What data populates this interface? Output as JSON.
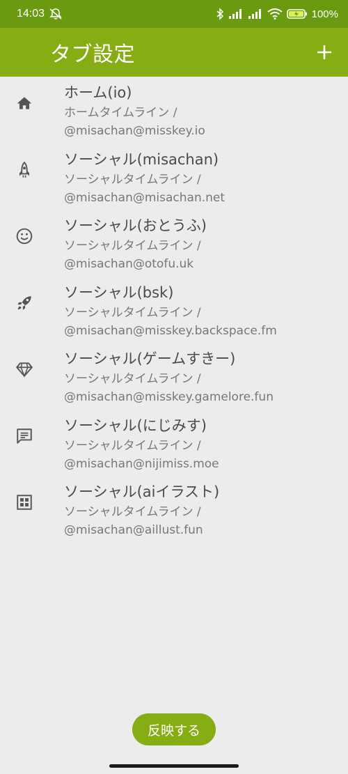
{
  "status": {
    "time": "14:03",
    "battery": "100%"
  },
  "appbar": {
    "title": "タブ設定"
  },
  "tabs": [
    {
      "name": "ホーム(io)",
      "type": "ホームタイムライン /",
      "account": "@misachan@misskey.io",
      "icon": "home-icon"
    },
    {
      "name": "ソーシャル(misachan)",
      "type": "ソーシャルタイムライン /",
      "account": "@misachan@misachan.net",
      "icon": "rocket-icon"
    },
    {
      "name": "ソーシャル(おとうふ)",
      "type": "ソーシャルタイムライン /",
      "account": "@misachan@otofu.uk",
      "icon": "smiley-icon"
    },
    {
      "name": "ソーシャル(bsk)",
      "type": "ソーシャルタイムライン /",
      "account": "@misachan@misskey.backspace.fm",
      "icon": "rocket-launch-icon"
    },
    {
      "name": "ソーシャル(ゲームすきー)",
      "type": "ソーシャルタイムライン /",
      "account": "@misachan@misskey.gamelore.fun",
      "icon": "diamond-icon"
    },
    {
      "name": "ソーシャル(にじみす)",
      "type": "ソーシャルタイムライン /",
      "account": "@misachan@nijimiss.moe",
      "icon": "chat-icon"
    },
    {
      "name": "ソーシャル(aiイラスト)",
      "type": "ソーシャルタイムライン /",
      "account": "@misachan@aillust.fun",
      "icon": "grid-icon"
    }
  ],
  "footer": {
    "apply_label": "反映する"
  },
  "colors": {
    "status_bar": "#6a9a10",
    "app_bar": "#86ad13",
    "background": "#ececec",
    "accent": "#86ad13"
  }
}
